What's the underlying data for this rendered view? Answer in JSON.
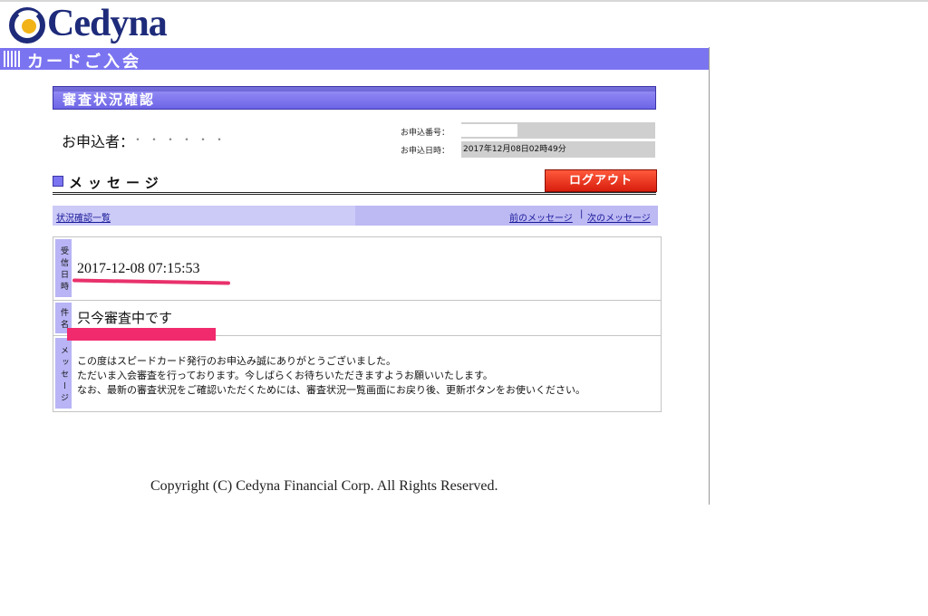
{
  "brand": {
    "name": "Cedyna",
    "accent": "#7b74f0",
    "logo_color": "#1e2b7a"
  },
  "header": {
    "title": "カードご入会"
  },
  "section": {
    "title": "審査状況確認"
  },
  "applicant": {
    "label": "お申込者：",
    "masked_name": "・・・・・・",
    "number_label": "お申込番号：",
    "date_label": "お申込日時：",
    "date_value": "2017年12月08日02時49分"
  },
  "message_heading": "メッセージ",
  "logout_label": "ログアウト",
  "nav": {
    "list_link": "状況確認一覧",
    "prev_link": "前のメッセージ",
    "separator": "|",
    "next_link": "次のメッセージ"
  },
  "detail": {
    "received_label": "受信日時",
    "received_value": "2017-12-08 07:15:53",
    "subject_label": "件名",
    "subject_value": "只今審査中です",
    "message_label": "メッセージ",
    "message_lines": [
      "この度はスピードカード発行のお申込み誠にありがとうございました。",
      "ただいま入会審査を行っております。今しばらくお待ちいただきますようお願いいたします。",
      "なお、最新の審査状況をご確認いただくためには、審査状況一覧画面にお戻り後、更新ボタンをお使いください。"
    ]
  },
  "footer": {
    "copyright": "Copyright (C) Cedyna Financial Corp. All Rights Reserved."
  }
}
